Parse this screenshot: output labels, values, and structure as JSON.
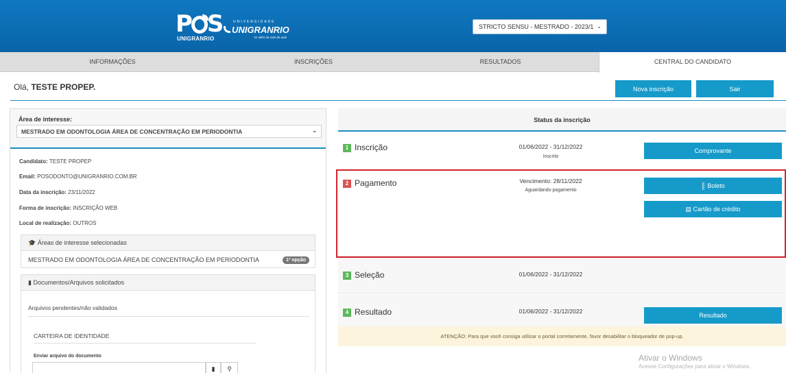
{
  "header": {
    "logo_main": "P S",
    "logo_sub": "UNIGRANRIO",
    "logo_uni_pre": "UNIVERSIDADE",
    "logo_uni": "UNIGRANRIO",
    "logo_uni_tag": "Vc além da sala de aula",
    "period_selected": "STRICTO SENSU - MESTRADO - 2023/1"
  },
  "nav": {
    "items": [
      "INFORMAÇÕES",
      "INSCRIÇÕES",
      "RESULTADOS",
      "CENTRAL DO CANDIDATO"
    ],
    "active_index": 3
  },
  "greeting": {
    "prefix": "Olá, ",
    "name": "TESTE PROPEP."
  },
  "actions": {
    "new_label": "Nova inscrição",
    "exit_label": "Sair"
  },
  "candidate": {
    "area_label": "Área de interesse:",
    "area_selected": "MESTRADO EM ODONTOLOGIA ÁREA DE CONCENTRAÇÃO EM PERIODONTIA",
    "fields": [
      {
        "label": "Candidato:",
        "value": "TESTE PROPEP"
      },
      {
        "label": "Email:",
        "value": "POSODONTO@UNIGRANRIO.COM.BR"
      },
      {
        "label": "Data da inscrição:",
        "value": "23/11/2022"
      },
      {
        "label": "Forma de inscrição:",
        "value": "INSCRIÇÃO WEB"
      },
      {
        "label": "Local de realização:",
        "value": "OUTROS"
      }
    ]
  },
  "areas_box": {
    "title": "Áreas de interesse selecionadas",
    "item": "MESTRADO EM ODONTOLOGIA ÁREA DE CONCENTRAÇÃO EM PERIODONTIA",
    "badge": "1ª opção"
  },
  "docs_box": {
    "title": "Documentos/Arquivos solicitados",
    "pending": "Arquivos pendentes/não validados",
    "doc_name": "CARTEIRA DE IDENTIDADE",
    "upload_label": "Enviar arquivo do documento"
  },
  "status": {
    "title": "Status da inscrição",
    "steps": [
      {
        "num": "1",
        "title": "Inscrição",
        "date": "01/06/2022 - 31/12/2022",
        "sub": "Inscrito",
        "color": "#5cb85c",
        "btn": "Comprovante"
      },
      {
        "num": "2",
        "title": "Pagamento",
        "date": "Vencimento: 28/11/2022",
        "sub": "Aguardando pagamento",
        "color": "#d9534f",
        "btn": "Boleto",
        "btn2": "Cartão de crédito"
      },
      {
        "num": "3",
        "title": "Seleção",
        "date": "01/06/2022 - 31/12/2022",
        "color": "#5cb85c"
      },
      {
        "num": "4",
        "title": "Resultado",
        "date": "01/06/2022 - 31/12/2022",
        "color": "#5cb85c",
        "btn": "Resultado"
      }
    ]
  },
  "warning": "ATENÇÃO: Para que você consiga utilizar o portal corretamente, favor desabilitar o bloqueador de pop-up.",
  "watermark": {
    "line1": "Ativar o Windows",
    "line2": "Acesse Configurações para ativar o Windows."
  },
  "colors": {
    "brand": "#0f78c1",
    "button": "#169ac9",
    "highlight": "#d2232a"
  }
}
